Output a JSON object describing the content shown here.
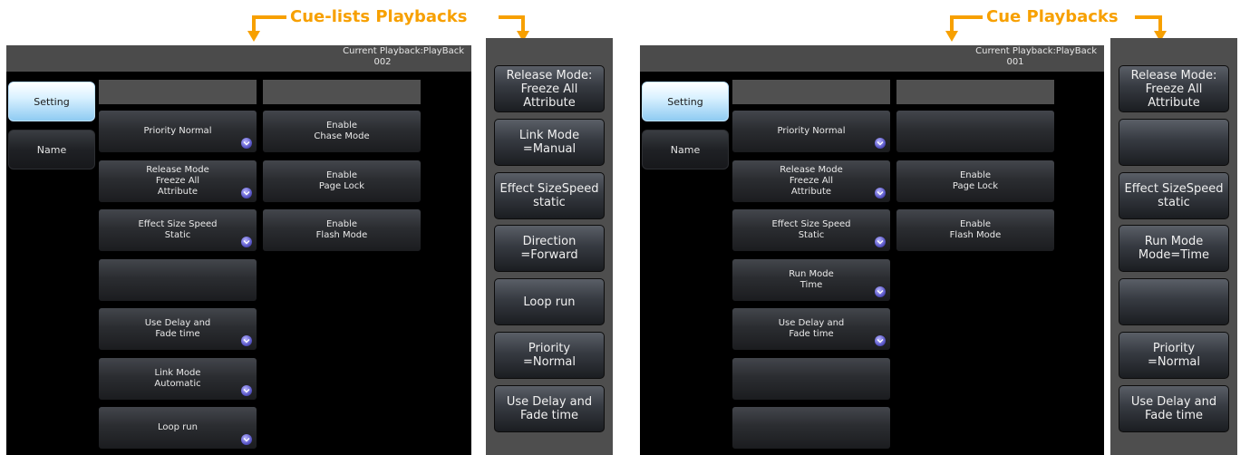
{
  "captions": {
    "left": "Cue-lists Playbacks",
    "right": "Cue Playbacks"
  },
  "left_screen": {
    "current_label": "Current Playback:PlayBack",
    "current_number": "002",
    "tabs": [
      "Setting",
      "Name"
    ],
    "col1": [
      {
        "lines": [
          "Priority Normal"
        ],
        "dropdown": true
      },
      {
        "lines": [
          "Release Mode",
          "Freeze All",
          "Attribute"
        ],
        "dropdown": true
      },
      {
        "lines": [
          "Effect Size Speed",
          "Static"
        ],
        "dropdown": true
      },
      {
        "lines": [],
        "dropdown": false
      },
      {
        "lines": [
          "Use Delay and",
          "Fade time"
        ],
        "dropdown": true
      },
      {
        "lines": [
          "Link Mode",
          "Automatic"
        ],
        "dropdown": true
      },
      {
        "lines": [
          "Loop run"
        ],
        "dropdown": true
      }
    ],
    "col2": [
      {
        "lines": [
          "Enable",
          "Chase Mode"
        ],
        "dropdown": false
      },
      {
        "lines": [
          "Enable",
          "Page Lock"
        ],
        "dropdown": false
      },
      {
        "lines": [
          "Enable",
          "Flash Mode"
        ],
        "dropdown": false
      }
    ]
  },
  "left_panel": [
    [
      "Release Mode:",
      "Freeze All",
      "Attribute"
    ],
    [
      "Link Mode",
      "=Manual"
    ],
    [
      "Effect SizeSpeed",
      "static"
    ],
    [
      "Direction",
      "=Forward"
    ],
    [
      "Loop run"
    ],
    [
      "Priority",
      "=Normal"
    ],
    [
      "Use Delay and",
      "Fade time"
    ]
  ],
  "right_screen": {
    "current_label": "Current Playback:PlayBack",
    "current_number": "001",
    "tabs": [
      "Setting",
      "Name"
    ],
    "col1": [
      {
        "lines": [
          "Priority Normal"
        ],
        "dropdown": true
      },
      {
        "lines": [
          "Release Mode",
          "Freeze All",
          "Attribute"
        ],
        "dropdown": true
      },
      {
        "lines": [
          "Effect Size Speed",
          "Static"
        ],
        "dropdown": true
      },
      {
        "lines": [
          "Run Mode",
          "Time"
        ],
        "dropdown": true
      },
      {
        "lines": [
          "Use Delay and",
          "Fade time"
        ],
        "dropdown": true
      },
      {
        "lines": [],
        "dropdown": false
      },
      {
        "lines": [],
        "dropdown": false
      }
    ],
    "col2": [
      {
        "lines": [],
        "dropdown": false
      },
      {
        "lines": [
          "Enable",
          "Page Lock"
        ],
        "dropdown": false
      },
      {
        "lines": [
          "Enable",
          "Flash Mode"
        ],
        "dropdown": false
      }
    ]
  },
  "right_panel": [
    [
      "Release Mode:",
      "Freeze All",
      "Attribute"
    ],
    [],
    [
      "Effect SizeSpeed",
      "static"
    ],
    [
      "Run Mode",
      "Mode=Time"
    ],
    [],
    [
      "Priority",
      "=Normal"
    ],
    [
      "Use Delay and",
      "Fade time"
    ]
  ],
  "colors": {
    "caption": "#f7a000",
    "screen_bg": "#000000",
    "topbar": "#4b4b4b",
    "panel": "#4e4e4e",
    "dropdown_icon": "#5b58c9"
  }
}
